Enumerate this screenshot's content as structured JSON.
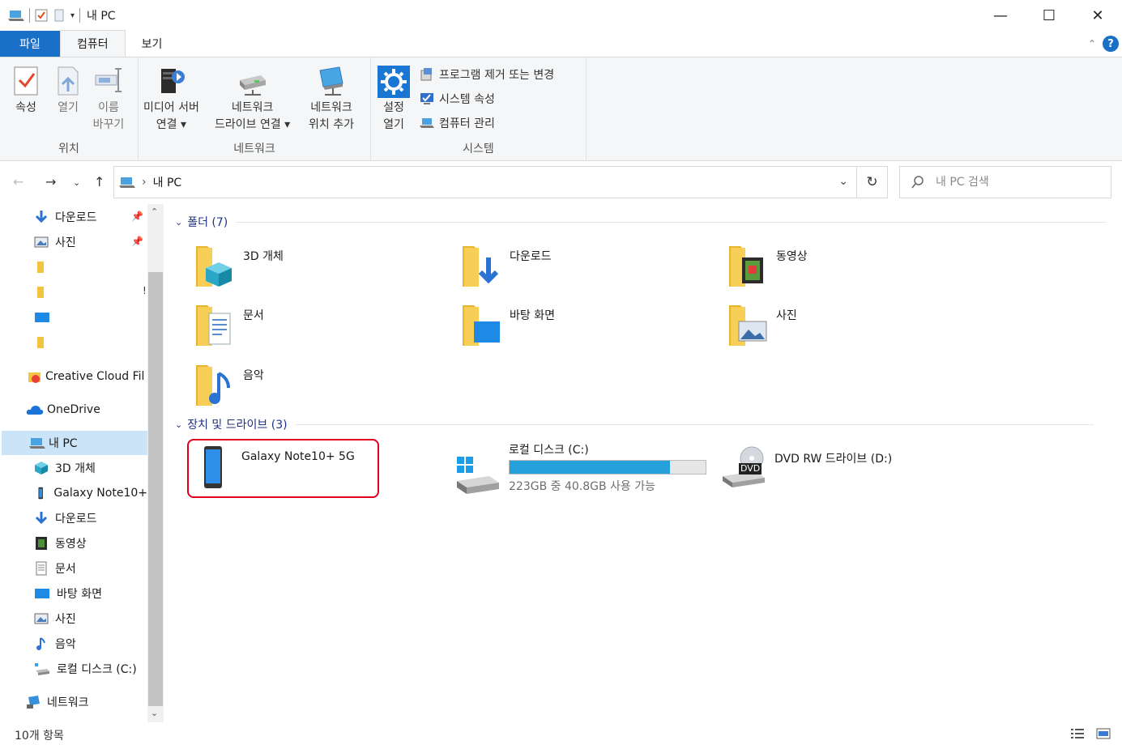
{
  "window": {
    "title": "내 PC",
    "minimize": "—",
    "maximize": "☐",
    "close": "✕"
  },
  "ribbon_tabs": [
    "파일",
    "컴퓨터",
    "보기"
  ],
  "ribbon": {
    "location_group": {
      "label": "위치",
      "properties": "속성",
      "open": "열기",
      "rename_1": "이름",
      "rename_2": "바꾸기"
    },
    "network_group": {
      "label": "네트워크",
      "media_1": "미디어 서버",
      "media_2": "연결 ▾",
      "map_1": "네트워크",
      "map_2": "드라이브 연결 ▾",
      "add_1": "네트워크",
      "add_2": "위치 추가"
    },
    "system_group": {
      "label": "시스템",
      "settings_1": "설정",
      "settings_2": "열기",
      "uninstall": "프로그램 제거 또는 변경",
      "sys_props": "시스템 속성",
      "manage": "컴퓨터 관리"
    }
  },
  "address": {
    "path": "내 PC",
    "separator": "›",
    "search_placeholder": "내 PC 검색"
  },
  "nav_pane": {
    "quick": [
      {
        "label": "다운로드",
        "pinned": true
      },
      {
        "label": "사진",
        "pinned": true
      }
    ],
    "creative_cloud": "Creative Cloud Fil",
    "onedrive": "OneDrive",
    "this_pc": "내 PC",
    "pc_children": [
      "3D 개체",
      "Galaxy Note10+",
      "다운로드",
      "동영상",
      "문서",
      "바탕 화면",
      "사진",
      "음악",
      "로컬 디스크 (C:)"
    ],
    "network": "네트워크",
    "stray_glyph": "!"
  },
  "content": {
    "folders_header": "폴더 (7)",
    "folders": [
      "3D 개체",
      "다운로드",
      "동영상",
      "문서",
      "바탕 화면",
      "사진",
      "음악"
    ],
    "devices_header": "장치 및 드라이브 (3)",
    "devices": {
      "phone": "Galaxy Note10+ 5G",
      "local_disk": "로컬 디스크 (C:)",
      "local_disk_free": "223GB 중 40.8GB 사용 가능",
      "local_disk_used_fraction": 0.817,
      "dvd": "DVD RW 드라이브 (D:)",
      "dvd_badge": "DVD"
    }
  },
  "status": {
    "item_count": "10개 항목"
  },
  "colors": {
    "accent": "#1a6fc6",
    "section": "#1e3287",
    "highlight": "#e0001b",
    "disk_fill": "#26a0da"
  }
}
